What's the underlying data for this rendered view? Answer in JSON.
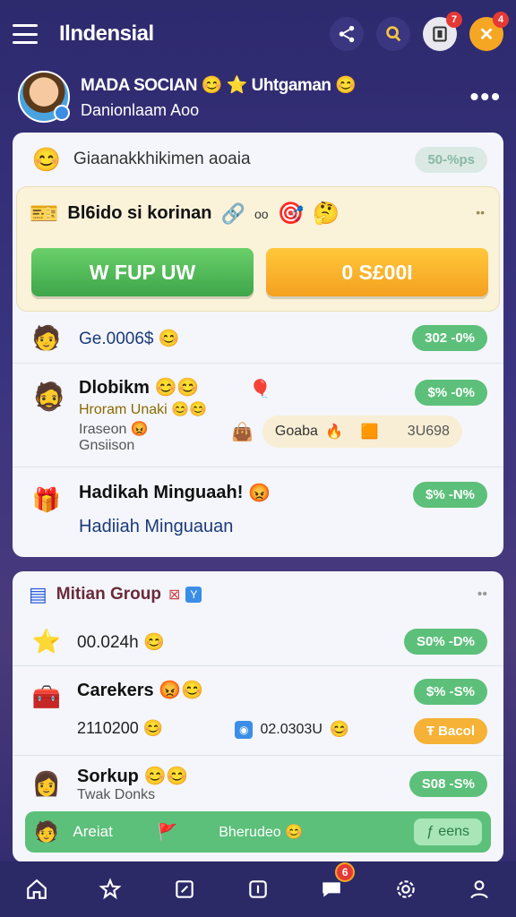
{
  "header": {
    "title": "Ilndensial",
    "icons": [
      "menu-icon",
      "share-icon",
      "search-icon",
      "inbox-icon",
      "close-icon"
    ],
    "inbox_badge": "7",
    "close_badge": "4"
  },
  "profile": {
    "name": "MADA SOCIAN 😊 ⭐ Uhtgaman 😊",
    "subtitle": "Danionlaam Aoo"
  },
  "card1": {
    "header_label": "Giaanakkhikimen aoaia",
    "header_pill": "50-%ps",
    "promo_title": "Bl6ido si korinan",
    "promo_small": "oo",
    "promo_dots": "••",
    "btn_left": "W FUP UW",
    "btn_right": "0 S£00I",
    "row1": {
      "amount": "Ge.0006$ 😊",
      "pill": "302 -0%"
    },
    "row2": {
      "title": "Dlobikm 😊😊",
      "line2": "Hroram Unaki 😊😊",
      "line3": "Iraseon 😡",
      "line4": "Gnsiison",
      "pill": "$% -0%",
      "chip_label": "Goaba",
      "chip_value": "3U698"
    },
    "row3": {
      "title": "Hadikah Minguaah!",
      "subtitle": "Hadiiah Minguauan",
      "pill": "$% -N%"
    }
  },
  "card2": {
    "group_title": "Mitian Group",
    "dots": "••",
    "row1": {
      "amount": "00.024h 😊",
      "pill": "S0% -D%"
    },
    "row2": {
      "title": "Carekers 😡😊",
      "amount": "2110200 😊",
      "mid_value": "02.0303U",
      "pill": "$% -S%",
      "btn": "Ŧ Bacol"
    },
    "row3": {
      "title": "Sorkup 😊😊",
      "subtitle": "Twak Donks",
      "pill": "S08 -S%"
    },
    "footer_left": "Areiat",
    "footer_mid": "Bherudeo 😊",
    "footer_btn": "ƒ eens"
  },
  "nav": {
    "items": [
      "home-icon",
      "star-icon",
      "edit-icon",
      "info-icon",
      "chat-icon",
      "settings-icon",
      "profile-icon"
    ],
    "chat_badge": "6"
  }
}
